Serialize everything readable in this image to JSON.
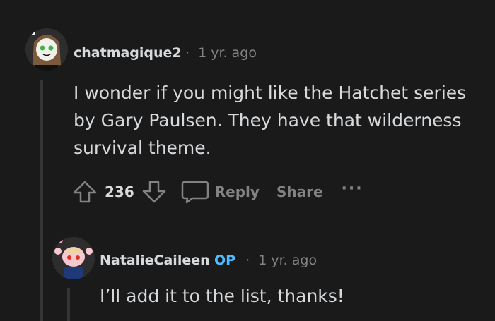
{
  "comments": [
    {
      "author": "chatmagique2",
      "separator": "·",
      "time": "1 yr. ago",
      "body": "I wonder if you might like the Hatchet series by Gary Paulsen. They have that wilderness survival theme.",
      "votes": "236",
      "reply_label": "Reply",
      "share_label": "Share",
      "more_label": "···"
    },
    {
      "author": "NatalieCaileen",
      "op_badge": "OP",
      "separator": "·",
      "time": "1 yr. ago",
      "body": "I’ll add it to the list, thanks!"
    }
  ],
  "icons": {
    "upvote": "arrow-up-icon",
    "downvote": "arrow-down-icon",
    "reply": "speech-bubble-icon",
    "more": "ellipsis-icon"
  },
  "colors": {
    "background": "#1a1a1b",
    "text": "#d7dadc",
    "muted": "#818384",
    "op": "#4fbcff",
    "thread": "#343536"
  }
}
